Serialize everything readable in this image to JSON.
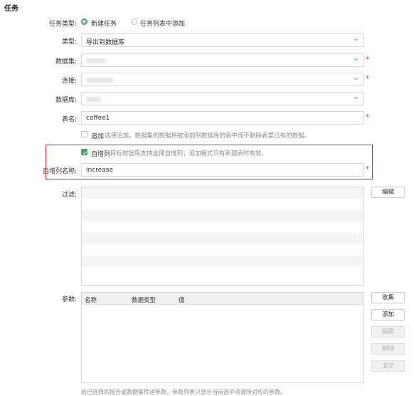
{
  "section_title": "任务",
  "task_type": {
    "label": "任务类型:",
    "options": [
      {
        "label": "新建任务",
        "selected": true
      },
      {
        "label": "任务列表中添加",
        "selected": false
      }
    ]
  },
  "type": {
    "label": "类型:",
    "value": "导出到数据库"
  },
  "dataset": {
    "label": "数据集:"
  },
  "connection": {
    "label": "连接:"
  },
  "database": {
    "label": "数据库:"
  },
  "table_name": {
    "label": "表名:",
    "value": "coffee1"
  },
  "append": {
    "label": "追加",
    "checked": false,
    "hint": "选择追加，数据集的数据将被添加到数据库的表中而不删除表里已有的数据。"
  },
  "auto_increment": {
    "label": "自增列",
    "checked": true,
    "hint": "目标数据库支持选择自增列；追加模式只有新建表时有效。"
  },
  "auto_increment_name": {
    "label": "自增列名称:",
    "value": "increase"
  },
  "filter": {
    "label": "过滤:",
    "edit_button": "编辑"
  },
  "params": {
    "label": "参数:",
    "columns": [
      "名称",
      "数据类型",
      "值"
    ],
    "buttons": {
      "collect": "收集",
      "add": "添加",
      "edit": "编辑",
      "delete": "删除",
      "clear": "清空"
    },
    "footnote": "给已选择的报告或数据集传递参数。参数列表只显示当前选中资源所对应的参数。"
  },
  "required_mark": "*",
  "colors": {
    "accent": "#3aa55f",
    "highlight": "#d9262b",
    "required": "#e03c3c"
  },
  "icons": [
    "chevron-down-icon",
    "check-icon"
  ]
}
